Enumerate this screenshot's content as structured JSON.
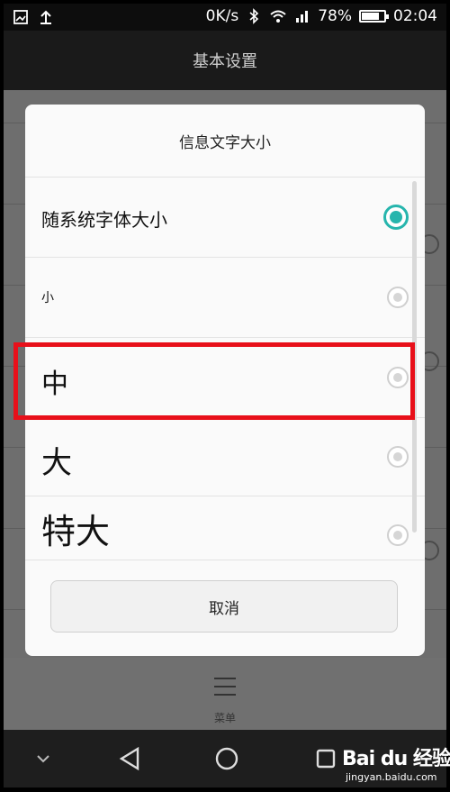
{
  "status_bar": {
    "speed": "0K/s",
    "battery": "78%",
    "battery_level": 0.78,
    "time": "02:04"
  },
  "header": {
    "title": "基本设置"
  },
  "dialog": {
    "title": "信息文字大小",
    "options": [
      {
        "label": "随系统字体大小",
        "selected": true
      },
      {
        "label": "小",
        "selected": false
      },
      {
        "label": "中",
        "selected": false
      },
      {
        "label": "大",
        "selected": false
      },
      {
        "label": "特大",
        "selected": false
      }
    ],
    "cancel_label": "取消"
  },
  "bottom_menu": {
    "label": "菜单"
  },
  "watermark": {
    "brand": "Bai du 经验",
    "url": "jingyan.baidu.com"
  },
  "colors": {
    "accent": "#26b5ad",
    "highlight": "#e8101a"
  }
}
